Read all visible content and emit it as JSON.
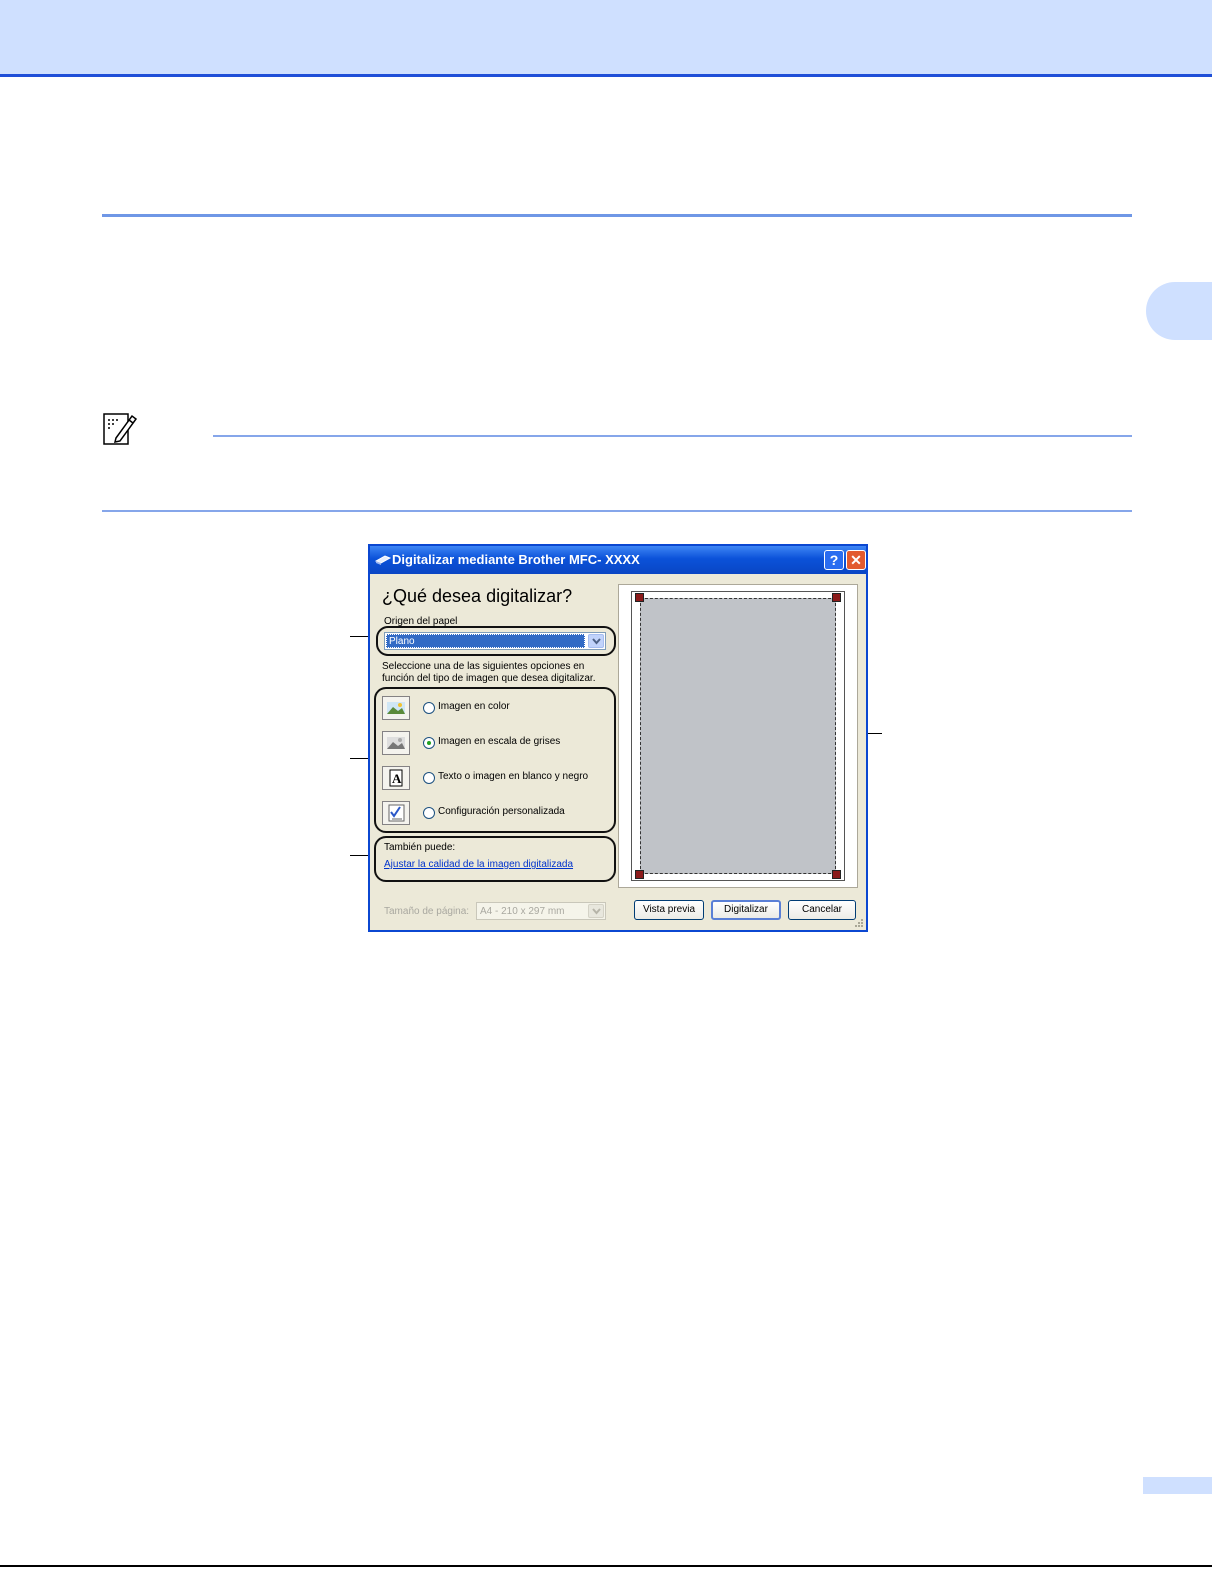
{
  "page": {
    "background_accent": "#cfe0ff",
    "rule_color": "#6f97e6",
    "note_icon": "pencil-note-icon"
  },
  "dialog": {
    "title": "Digitalizar mediante Brother MFC- XXXX",
    "title_icon": "scanner-icon",
    "help_label": "?",
    "close_label": "✕",
    "heading": "¿Qué desea digitalizar?",
    "paper_source_label": "Origen del papel",
    "paper_source_value": "Plano",
    "instructions_line1": "Seleccione una de las siguientes opciones en",
    "instructions_line2": "función del tipo de imagen que desea digitalizar.",
    "options": [
      {
        "label": "Imagen en color",
        "icon": "color-photo-icon",
        "checked": false
      },
      {
        "label": "Imagen en escala de grises",
        "icon": "grayscale-photo-icon",
        "checked": true
      },
      {
        "label": "Texto o imagen en blanco y negro",
        "icon": "bw-text-icon",
        "checked": false
      },
      {
        "label": "Configuración personalizada",
        "icon": "custom-settings-icon",
        "checked": false
      }
    ],
    "also_label": "También puede:",
    "adjust_link": "Ajustar la calidad de la imagen digitalizada",
    "page_size_label": "Tamaño de página:",
    "page_size_value": "A4 - 210 x 297 mm",
    "buttons": {
      "preview": "Vista previa",
      "scan": "Digitalizar",
      "cancel": "Cancelar"
    }
  }
}
